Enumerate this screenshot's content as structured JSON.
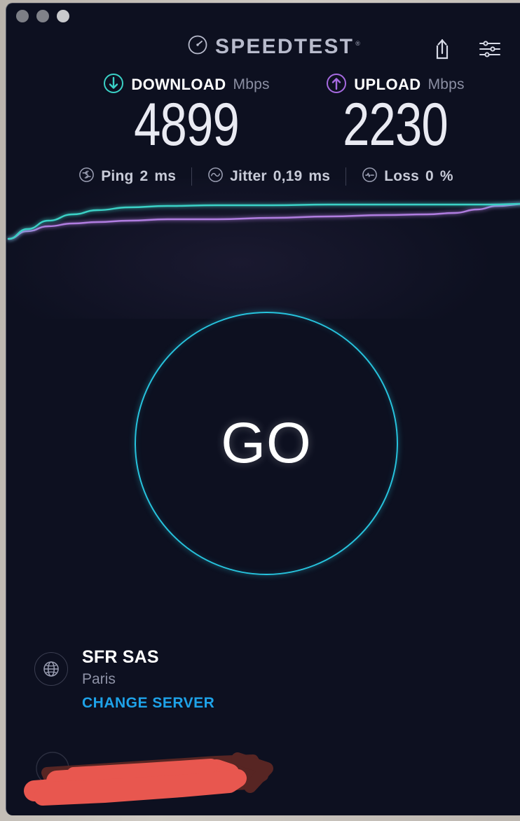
{
  "window": {
    "app_title": "Speedtest",
    "traffic_lights": [
      "close",
      "minimize",
      "zoom"
    ],
    "background_color": "#0d1020"
  },
  "header": {
    "brand": "SPEEDTEST",
    "trademark": "®",
    "logo_icon": "speedometer-gauge-icon",
    "actions": [
      {
        "name": "share-button",
        "icon": "share-upload-icon"
      },
      {
        "name": "settings-button",
        "icon": "sliders-settings-icon"
      }
    ]
  },
  "results": {
    "download": {
      "label": "DOWNLOAD",
      "unit": "Mbps",
      "value": "4899",
      "icon": "download-arrow-circle-icon",
      "color": "#3ad1c6"
    },
    "upload": {
      "label": "UPLOAD",
      "unit": "Mbps",
      "value": "2230",
      "icon": "upload-arrow-circle-icon",
      "color": "#a66ae0"
    }
  },
  "stats": {
    "ping": {
      "label": "Ping",
      "value": "2",
      "unit": "ms",
      "icon": "ping-latency-icon"
    },
    "jitter": {
      "label": "Jitter",
      "value": "0,19",
      "unit": "ms",
      "icon": "jitter-wave-icon"
    },
    "loss": {
      "label": "Loss",
      "value": "0",
      "unit": "%",
      "icon": "packet-loss-icon"
    }
  },
  "chart_data": {
    "type": "line",
    "title": "",
    "xlabel": "",
    "ylabel": "Mbps",
    "grid": false,
    "legend": "none",
    "xlim": [
      0,
      742
    ],
    "ylim": [
      0,
      120
    ],
    "series": [
      {
        "name": "Download",
        "color": "#3ad1c6",
        "x": [
          3,
          30,
          60,
          95,
          130,
          175,
          230,
          300,
          380,
          460,
          540,
          620,
          690,
          742
        ],
        "y": [
          66,
          52,
          40,
          31,
          25,
          21,
          19,
          18,
          18,
          17,
          17,
          17,
          17,
          16
        ]
      },
      {
        "name": "Upload",
        "color": "#b07de0",
        "x": [
          3,
          30,
          60,
          95,
          130,
          175,
          230,
          300,
          380,
          460,
          540,
          600,
          640,
          672,
          700,
          742
        ],
        "y": [
          66,
          55,
          48,
          44,
          42,
          40,
          38,
          38,
          36,
          34,
          32,
          31,
          29,
          24,
          19,
          16
        ]
      }
    ]
  },
  "go_button": {
    "label": "GO",
    "color": "#27c3dd"
  },
  "server": {
    "icon": "globe-icon",
    "name": "SFR SAS",
    "location": "Paris",
    "change_label": "CHANGE SERVER",
    "change_color": "#1ea2e8"
  },
  "connection": {
    "redacted": true,
    "redaction_colors": [
      "#e8574f",
      "#5b2724"
    ]
  }
}
